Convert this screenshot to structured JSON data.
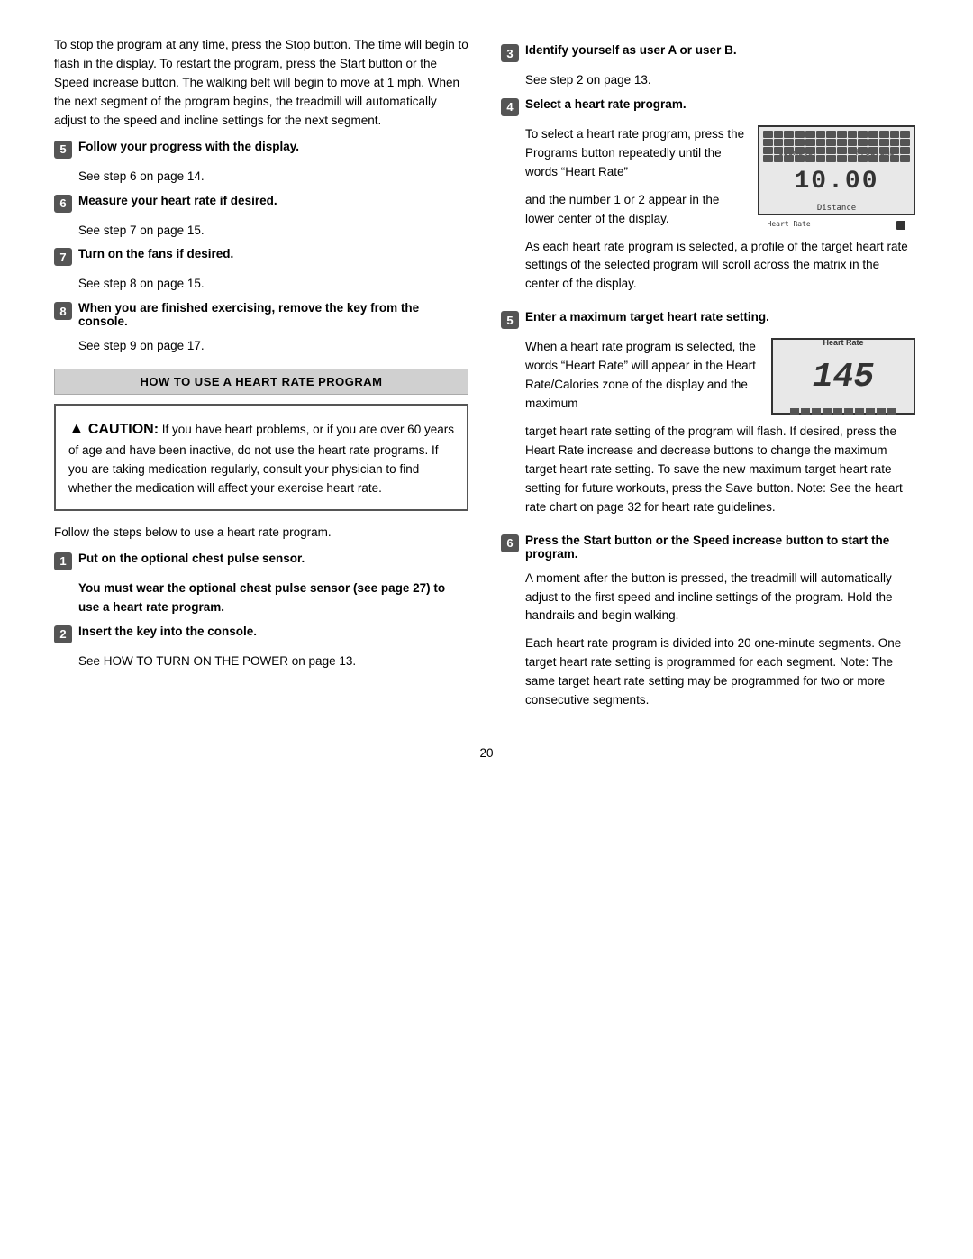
{
  "intro_text": "To stop the program at any time, press the Stop button. The time will begin to flash in the display. To restart the program, press the Start button or the Speed increase button. The walking belt will begin to move at 1 mph. When the next segment of the program begins, the treadmill will automatically adjust to the speed and incline settings for the next segment.",
  "left_steps": [
    {
      "num": "5",
      "title": "Follow your progress with the display.",
      "body": "See step 6 on page 14."
    },
    {
      "num": "6",
      "title": "Measure your heart rate if desired.",
      "body": "See step 7 on page 15."
    },
    {
      "num": "7",
      "title": "Turn on the fans if desired.",
      "body": "See step 8 on page 15."
    },
    {
      "num": "8",
      "title": "When you are finished exercising, remove the key from the console.",
      "body": "See step 9 on page 17."
    }
  ],
  "how_to_title": "HOW TO USE A HEART RATE PROGRAM",
  "caution": {
    "title": "CAUTION:",
    "text": " If you have heart problems, or if you are over 60 years of age and have been inactive, do not use the heart rate programs. If you are taking medication regularly, consult your physician to find whether the medication will affect your exercise heart rate."
  },
  "follow_steps_text": "Follow the steps below to use a heart rate program.",
  "right_steps_top": [
    {
      "num": "1",
      "title": "Put on the optional chest pulse sensor.",
      "bold_body": "You must wear the optional chest pulse sensor (see page 27) to use a heart rate program."
    },
    {
      "num": "2",
      "title": "Insert the key into the console.",
      "body": "See HOW TO TURN ON THE POWER on page 13."
    }
  ],
  "right_col": {
    "step3": {
      "num": "3",
      "title": "Identify yourself as user A or user B.",
      "body": "See step 2 on page 13."
    },
    "step4": {
      "num": "4",
      "title": "Select a heart rate program.",
      "body_before": "To select a heart rate program, press the Programs button repeatedly until the words “Heart Rate”",
      "body_after": "and the number 1 or 2 appear in the lower center of the display.",
      "profile_text": "As each heart rate program is selected, a profile of the target heart rate settings of the selected program will scroll across the matrix in the center of the display."
    },
    "step5": {
      "num": "5",
      "title": "Enter a maximum target heart rate setting.",
      "body_before": "When a heart rate program is selected, the words “Heart Rate” will appear in the Heart Rate/Calories zone of the display and the maximum",
      "body_after": "target heart rate setting of the program will flash. If desired, press the Heart Rate increase and decrease buttons to change the maximum target heart rate setting. To save the new maximum target heart rate setting for future workouts, press the Save button. Note: See the heart rate chart on page 32 for heart rate guidelines.",
      "display_num": "145"
    },
    "step6": {
      "num": "6",
      "title": "Press the Start button or the Speed increase button to start the program.",
      "body1": "A moment after the button is pressed, the treadmill will automatically adjust to the first speed and incline settings of the program. Hold the handrails and begin walking.",
      "body2": "Each heart rate program is divided into 20 one-minute segments. One target heart rate setting is programmed for each segment. Note: The same target heart rate setting may be programmed for two or more consecutive segments."
    }
  },
  "display1": {
    "label_odometer": "Odometer",
    "label_programs": "Programs",
    "digits": "10.00",
    "label_distance": "Distance",
    "label_heart_rate": "Heart Rate"
  },
  "display2": {
    "label_heart_rate": "Heart Rate",
    "number": "145"
  },
  "page_num": "20"
}
